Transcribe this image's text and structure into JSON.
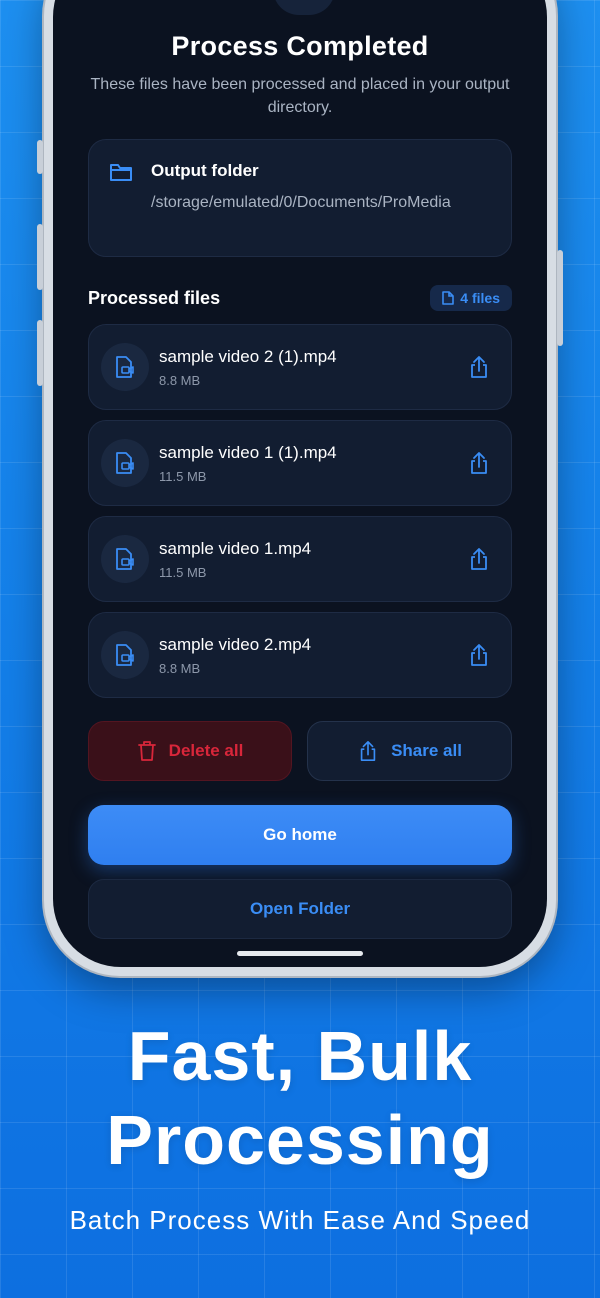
{
  "screen": {
    "title": "Process Completed",
    "subtitle": "These files have been processed and placed in your output directory."
  },
  "output_folder": {
    "label": "Output folder",
    "path": "/storage/emulated/0/Documents/ProMedia",
    "icon": "folder-icon"
  },
  "processed": {
    "label": "Processed files",
    "count_label": "4 files",
    "files": [
      {
        "name": "sample video 2 (1).mp4",
        "size": "8.8 MB"
      },
      {
        "name": "sample video 1 (1).mp4",
        "size": "11.5 MB"
      },
      {
        "name": "sample video 1.mp4",
        "size": "11.5 MB"
      },
      {
        "name": "sample video 2.mp4",
        "size": "8.8 MB"
      }
    ]
  },
  "actions": {
    "delete_all": "Delete all",
    "share_all": "Share all",
    "go_home": "Go home",
    "open_folder": "Open Folder"
  },
  "promo": {
    "headline_line1": "Fast, Bulk",
    "headline_line2": "Processing",
    "tagline": "Batch Process With Ease And Speed"
  },
  "colors": {
    "background": "#1582ea",
    "screen": "#0b1220",
    "accent": "#3a8df5",
    "danger": "#d8263a"
  }
}
